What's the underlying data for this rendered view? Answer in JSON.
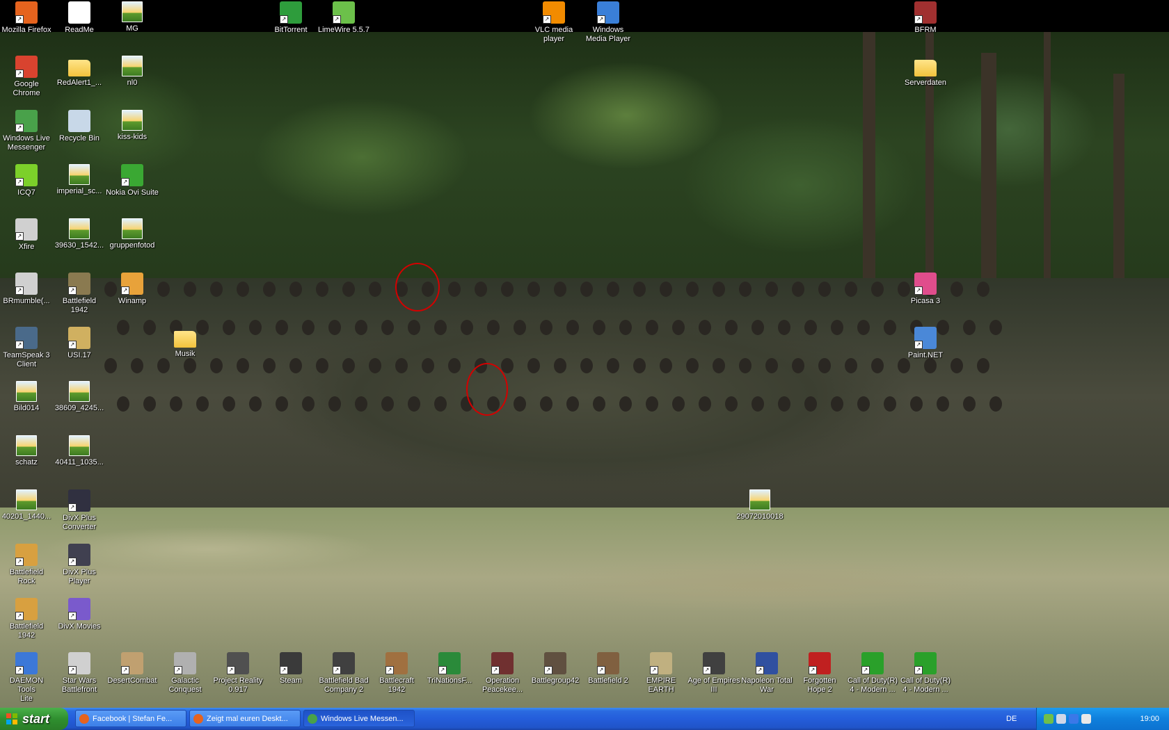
{
  "desktop": {
    "icons": [
      {
        "label": "Mozilla Firefox",
        "icon": "firefox-icon",
        "color": "#e5631e",
        "shortcut": true
      },
      {
        "label": "ReadMe",
        "icon": "document-icon",
        "color": "#ffffff",
        "shortcut": false
      },
      {
        "label": "MG",
        "icon": "image-file-icon",
        "color": "#f0c060",
        "shortcut": false
      },
      {
        "label": "BitTorrent",
        "icon": "bittorrent-icon",
        "color": "#2e9c3c",
        "shortcut": true
      },
      {
        "label": "LimeWire 5.5.7",
        "icon": "limewire-icon",
        "color": "#6cc04a",
        "shortcut": true
      },
      {
        "label": "VLC media\nplayer",
        "icon": "vlc-icon",
        "color": "#f28b00",
        "shortcut": true
      },
      {
        "label": "Windows\nMedia Player",
        "icon": "media-player-icon",
        "color": "#3a7fd8",
        "shortcut": true
      },
      {
        "label": "BFRM",
        "icon": "bfrm-icon",
        "color": "#a03030",
        "shortcut": true
      },
      {
        "label": "Google\nChrome",
        "icon": "chrome-icon",
        "color": "#d9432f",
        "shortcut": true
      },
      {
        "label": "RedAlert1_...",
        "icon": "folder-icon",
        "color": "#f2c23c",
        "shortcut": false
      },
      {
        "label": "nl0",
        "icon": "image-file-icon",
        "color": "#f0c060",
        "shortcut": false
      },
      {
        "label": "Serverdaten",
        "icon": "folder-icon",
        "color": "#f2c23c",
        "shortcut": false
      },
      {
        "label": "Windows Live\nMessenger",
        "icon": "messenger-icon",
        "color": "#49a14a",
        "shortcut": true
      },
      {
        "label": "Recycle Bin",
        "icon": "recycle-bin-icon",
        "color": "#c8d8e8",
        "shortcut": false
      },
      {
        "label": "kiss-kids",
        "icon": "image-file-icon",
        "color": "#f0c060",
        "shortcut": false
      },
      {
        "label": "ICQ7",
        "icon": "icq-icon",
        "color": "#7cd02a",
        "shortcut": true
      },
      {
        "label": "imperial_sc...",
        "icon": "image-file-icon",
        "color": "#f0c060",
        "shortcut": false
      },
      {
        "label": "Nokia Ovi Suite",
        "icon": "ovi-icon",
        "color": "#3aa833",
        "shortcut": true
      },
      {
        "label": "Xfire",
        "icon": "xfire-icon",
        "color": "#d0d0d0",
        "shortcut": true
      },
      {
        "label": "39630_1542...",
        "icon": "image-file-icon",
        "color": "#f0c060",
        "shortcut": false
      },
      {
        "label": "gruppenfotod",
        "icon": "image-file-icon",
        "color": "#f0c060",
        "shortcut": false
      },
      {
        "label": "BRmumble(...",
        "icon": "mumble-icon",
        "color": "#d0d0d0",
        "shortcut": true
      },
      {
        "label": "Battlefield\n1942",
        "icon": "battlefield-icon",
        "color": "#8a7a50",
        "shortcut": true
      },
      {
        "label": "Winamp",
        "icon": "winamp-icon",
        "color": "#e8a23a",
        "shortcut": true
      },
      {
        "label": "Picasa 3",
        "icon": "picasa-icon",
        "color": "#e04d8c",
        "shortcut": true
      },
      {
        "label": "TeamSpeak 3\nClient",
        "icon": "teamspeak-icon",
        "color": "#4a6a8a",
        "shortcut": true
      },
      {
        "label": "USI.17",
        "icon": "usi-icon",
        "color": "#d0b060",
        "shortcut": true
      },
      {
        "label": "Musik",
        "icon": "music-folder-icon",
        "color": "#f2c23c",
        "shortcut": false
      },
      {
        "label": "Paint.NET",
        "icon": "paint-net-icon",
        "color": "#4a88d8",
        "shortcut": true
      },
      {
        "label": "Bild014",
        "icon": "image-file-icon",
        "color": "#f0c060",
        "shortcut": false
      },
      {
        "label": "38609_4245...",
        "icon": "image-file-icon",
        "color": "#f0c060",
        "shortcut": false
      },
      {
        "label": "schatz",
        "icon": "image-file-icon",
        "color": "#f0c060",
        "shortcut": false
      },
      {
        "label": "40411_1035...",
        "icon": "image-file-icon",
        "color": "#f0c060",
        "shortcut": false
      },
      {
        "label": "40201_1440...",
        "icon": "image-file-icon",
        "color": "#f0c060",
        "shortcut": false
      },
      {
        "label": "DivX Plus\nConverter",
        "icon": "divx-converter-icon",
        "color": "#303040",
        "shortcut": true
      },
      {
        "label": "29072010018",
        "icon": "image-file-icon",
        "color": "#f0c060",
        "shortcut": false
      },
      {
        "label": "Battlefield\nRock",
        "icon": "battlefield-rock-icon",
        "color": "#d8a040",
        "shortcut": true
      },
      {
        "label": "DivX Plus\nPlayer",
        "icon": "divx-player-icon",
        "color": "#404050",
        "shortcut": true
      },
      {
        "label": "Battlefield\n1942",
        "icon": "battlefield-doc-icon",
        "color": "#d8a040",
        "shortcut": true
      },
      {
        "label": "DivX Movies",
        "icon": "divx-movies-icon",
        "color": "#7a5acc",
        "shortcut": true
      },
      {
        "label": "DAEMON Tools\nLite",
        "icon": "daemon-tools-icon",
        "color": "#3c78d8",
        "shortcut": true
      },
      {
        "label": "Star Wars\nBattlefront",
        "icon": "star-wars-icon",
        "color": "#d0d0d0",
        "shortcut": true
      },
      {
        "label": "DesertCombat",
        "icon": "desert-combat-icon",
        "color": "#c0a070",
        "shortcut": true
      },
      {
        "label": "Galactic\nConquest",
        "icon": "galactic-conquest-icon",
        "color": "#b0b0b0",
        "shortcut": true
      },
      {
        "label": "Project Reality\n0.917",
        "icon": "project-reality-icon",
        "color": "#505050",
        "shortcut": true
      },
      {
        "label": "Steam",
        "icon": "steam-icon",
        "color": "#3a3a3a",
        "shortcut": true
      },
      {
        "label": "Battlefield Bad\nCompany 2",
        "icon": "bfbc2-icon",
        "color": "#404040",
        "shortcut": true
      },
      {
        "label": "Battlecraft\n1942",
        "icon": "battlecraft-icon",
        "color": "#a07040",
        "shortcut": true
      },
      {
        "label": "TriNationsF...",
        "icon": "trinations-icon",
        "color": "#2a8a3a",
        "shortcut": true
      },
      {
        "label": "Operation\nPeacekee...",
        "icon": "operation-peacekeeper-icon",
        "color": "#703030",
        "shortcut": true
      },
      {
        "label": "Battlegroup42",
        "icon": "battlegroup42-icon",
        "color": "#605040",
        "shortcut": true
      },
      {
        "label": "Battlefield 2",
        "icon": "battlefield2-icon",
        "color": "#806040",
        "shortcut": true
      },
      {
        "label": "EMPIRE\nEARTH",
        "icon": "empire-earth-icon",
        "color": "#c0b080",
        "shortcut": true
      },
      {
        "label": "Age of Empires\nIII",
        "icon": "age-of-empires-icon",
        "color": "#404040",
        "shortcut": true
      },
      {
        "label": "Napoleon Total\nWar",
        "icon": "napoleon-icon",
        "color": "#3050a0",
        "shortcut": true
      },
      {
        "label": "Forgotten\nHope 2",
        "icon": "forgotten-hope-icon",
        "color": "#c02020",
        "shortcut": true
      },
      {
        "label": "Call of Duty(R)\n4 - Modern ...",
        "icon": "cod4-icon",
        "color": "#2aa02a",
        "shortcut": true
      },
      {
        "label": "Call of Duty(R)\n4 - Modern ...",
        "icon": "cod4-mp-icon",
        "color": "#2aa02a",
        "shortcut": true
      }
    ]
  },
  "taskbar": {
    "start_label": "start",
    "tasks": [
      {
        "label": "Facebook | Stefan Fe...",
        "icon": "firefox-icon",
        "color": "#e5631e",
        "active": false
      },
      {
        "label": "Zeigt mal euren Deskt...",
        "icon": "firefox-icon",
        "color": "#e5631e",
        "active": false
      },
      {
        "label": "Windows Live Messen...",
        "icon": "messenger-icon",
        "color": "#49a14a",
        "active": true
      }
    ],
    "language": "DE",
    "tray_icons": [
      {
        "icon": "network-icon",
        "color": "#6fbf4a"
      },
      {
        "icon": "volume-icon",
        "color": "#d0d8e8"
      },
      {
        "icon": "bluetooth-icon",
        "color": "#3a78e8"
      },
      {
        "icon": "display-icon",
        "color": "#e8e8e8"
      }
    ],
    "clock": "19:00"
  }
}
